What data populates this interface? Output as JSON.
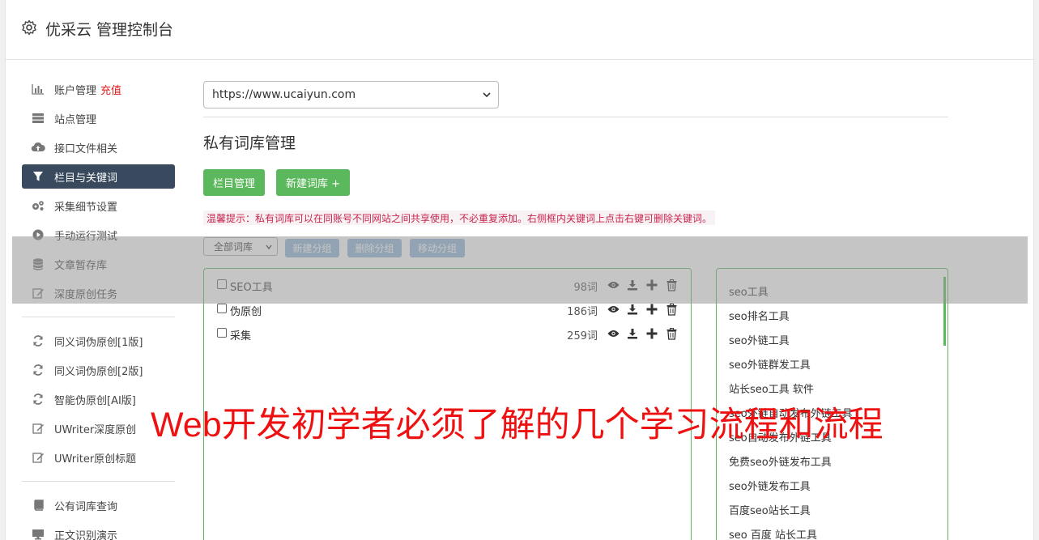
{
  "header": {
    "title": "优采云 管理控制台"
  },
  "sidebar": {
    "group1": [
      {
        "label": "账户管理",
        "extra": "充值",
        "icon": "bar-chart-icon"
      },
      {
        "label": "站点管理",
        "icon": "server-icon"
      },
      {
        "label": "接口文件相关",
        "icon": "cloud-upload-icon"
      },
      {
        "label": "栏目与关键词",
        "icon": "filter-icon",
        "active": true
      },
      {
        "label": "采集细节设置",
        "icon": "gears-icon"
      },
      {
        "label": "手动运行测试",
        "icon": "play-circle-icon"
      },
      {
        "label": "文章暂存库",
        "icon": "database-icon"
      },
      {
        "label": "深度原创任务",
        "icon": "edit-icon"
      }
    ],
    "group2": [
      {
        "label": "同义词伪原创[1版]",
        "icon": "refresh-icon"
      },
      {
        "label": "同义词伪原创[2版]",
        "icon": "refresh-icon"
      },
      {
        "label": "智能伪原创[AI版]",
        "icon": "refresh-icon"
      },
      {
        "label": "UWriter深度原创",
        "icon": "edit-icon"
      },
      {
        "label": "UWriter原创标题",
        "icon": "edit-icon"
      }
    ],
    "group3": [
      {
        "label": "公有词库查询",
        "icon": "book-icon"
      },
      {
        "label": "正文识别演示",
        "icon": "desktop-icon"
      }
    ]
  },
  "main": {
    "site_select": "https://www.ucaiyun.com",
    "section_title": "私有词库管理",
    "btn_column": "栏目管理",
    "btn_new_lib": "新建词库 +",
    "tip": "温馨提示：私有词库可以在同账号不同网站之间共享使用，不必重复添加。右侧框内关键词上点击右键可删除关键词。",
    "filter_select": "全部词库",
    "btn_new_group": "新建分组",
    "btn_del_group": "删除分组",
    "btn_move_group": "移动分组",
    "groups": [
      {
        "name": "SEO工具",
        "count": "98词"
      },
      {
        "name": "伪原创",
        "count": "186词"
      },
      {
        "name": "采集",
        "count": "259词"
      }
    ],
    "keywords": [
      "seo工具",
      "seo排名工具",
      "seo外链工具",
      "seo外链群发工具",
      "站长seo工具 软件",
      "seo外链自动发布外链工具",
      "seo自动发布外链工具",
      "免费seo外链发布工具",
      "seo外链发布工具",
      "百度seo站长工具",
      "seo 百度 站长工具"
    ]
  },
  "overlay": {
    "headline": "Web开发初学者必须了解的几个学习流程和流程"
  },
  "colors": {
    "active_nav": "#3a4a5e",
    "green": "#5cb85c",
    "blue_btn": "#8fb4d9",
    "headline": "#ee1111",
    "recharge": "#e01c1c"
  }
}
